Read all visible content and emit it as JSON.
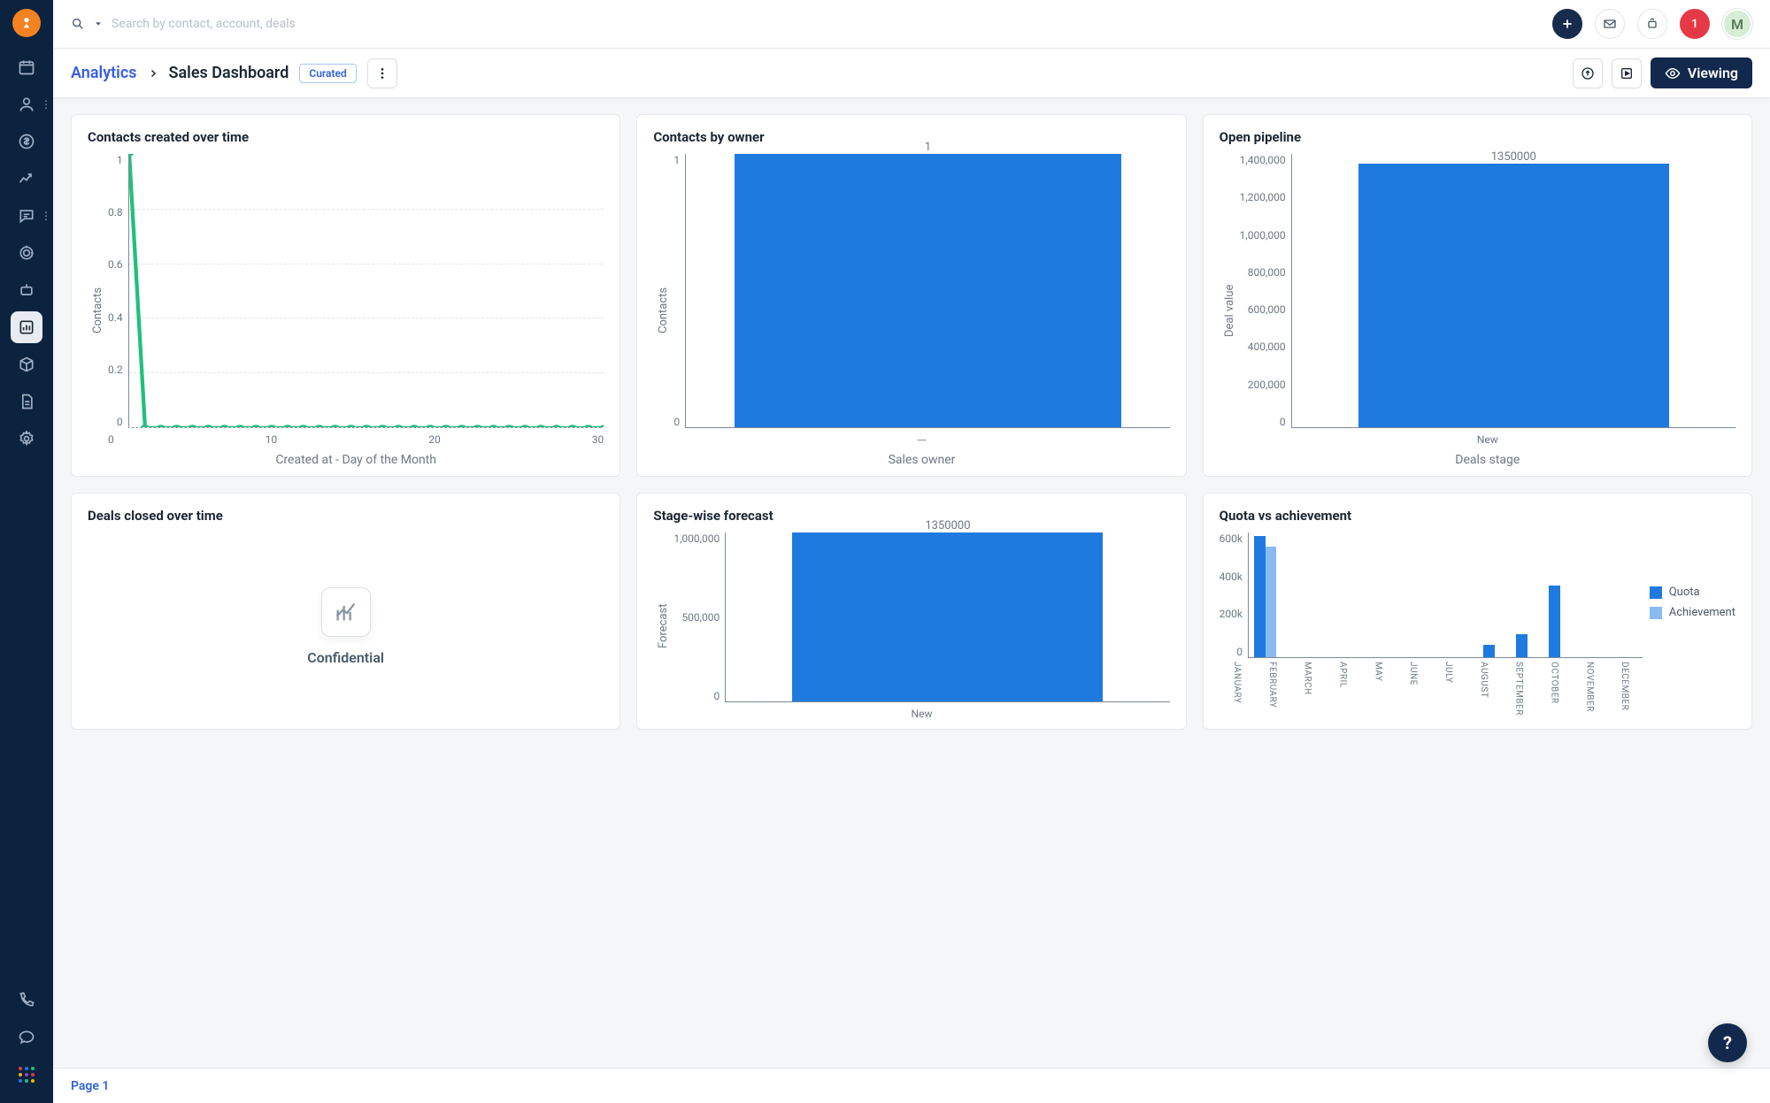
{
  "topbar": {
    "search_placeholder": "Search by contact, account, deals",
    "notification_count": "1",
    "avatar_initial": "M"
  },
  "breadcrumb": {
    "parent": "Analytics",
    "current": "Sales Dashboard",
    "badge": "Curated"
  },
  "toolbar": {
    "viewing_label": "Viewing"
  },
  "cards": {
    "c1": {
      "title": "Contacts created over time",
      "ylabel": "Contacts",
      "xlabel": "Created at - Day of the Month"
    },
    "c2": {
      "title": "Contacts by owner",
      "ylabel": "Contacts",
      "xlabel": "Sales owner"
    },
    "c3": {
      "title": "Open pipeline",
      "ylabel": "Deal value",
      "xlabel": "Deals stage"
    },
    "c4": {
      "title": "Deals closed over time",
      "empty_text": "Confidential"
    },
    "c5": {
      "title": "Stage-wise forecast",
      "ylabel": "Forecast"
    },
    "c6": {
      "title": "Quota vs achievement",
      "legend_quota": "Quota",
      "legend_ach": "Achievement"
    }
  },
  "footer": {
    "page_label": "Page 1"
  },
  "chart_data": [
    {
      "id": "contacts_over_time",
      "type": "line",
      "title": "Contacts created over time",
      "xlabel": "Created at - Day of the Month",
      "ylabel": "Contacts",
      "ylim": [
        0,
        1
      ],
      "y_ticks": [
        "1",
        "0.8",
        "0.6",
        "0.4",
        "0.2",
        "0"
      ],
      "x_ticks": [
        "0",
        "10",
        "20",
        "30"
      ],
      "x": [
        1,
        2,
        3,
        4,
        5,
        6,
        7,
        8,
        9,
        10,
        11,
        12,
        13,
        14,
        15,
        16,
        17,
        18,
        19,
        20,
        21,
        22,
        23,
        24,
        25,
        26,
        27,
        28,
        29,
        30,
        31
      ],
      "values": [
        1,
        0,
        0,
        0,
        0,
        0,
        0,
        0,
        0,
        0,
        0,
        0,
        0,
        0,
        0,
        0,
        0,
        0,
        0,
        0,
        0,
        0,
        0,
        0,
        0,
        0,
        0,
        0,
        0,
        0,
        0
      ],
      "color": "#22c07a"
    },
    {
      "id": "contacts_by_owner",
      "type": "bar",
      "title": "Contacts by owner",
      "xlabel": "Sales owner",
      "ylabel": "Contacts",
      "ylim": [
        0,
        1
      ],
      "y_ticks": [
        "1",
        "0"
      ],
      "categories": [
        "---"
      ],
      "values": [
        1
      ],
      "bar_label": "1"
    },
    {
      "id": "open_pipeline",
      "type": "bar",
      "title": "Open pipeline",
      "xlabel": "Deals stage",
      "ylabel": "Deal value",
      "ylim": [
        0,
        1400000
      ],
      "y_ticks": [
        "1,400,000",
        "1,200,000",
        "1,000,000",
        "800,000",
        "600,000",
        "400,000",
        "200,000",
        "0"
      ],
      "categories": [
        "New"
      ],
      "values": [
        1350000
      ],
      "bar_label": "1350000"
    },
    {
      "id": "stage_forecast",
      "type": "bar",
      "title": "Stage-wise forecast",
      "ylabel": "Forecast",
      "ylim": [
        0,
        1350000
      ],
      "y_ticks": [
        "1,000,000",
        "500,000",
        "0"
      ],
      "categories": [
        "New"
      ],
      "values": [
        1350000
      ],
      "bar_label": "1350000"
    },
    {
      "id": "quota_vs_achievement",
      "type": "bar",
      "title": "Quota vs achievement",
      "ylim": [
        0,
        700000
      ],
      "y_ticks": [
        "600k",
        "400k",
        "200k",
        "0"
      ],
      "categories": [
        "JANUARY",
        "FEBRUARY",
        "MARCH",
        "APRIL",
        "MAY",
        "JUNE",
        "JULY",
        "AUGUST",
        "SEPTEMBER",
        "OCTOBER",
        "NOVEMBER",
        "DECEMBER"
      ],
      "series": [
        {
          "name": "Quota",
          "color": "#1f7ae0",
          "values": [
            680000,
            0,
            0,
            0,
            0,
            0,
            0,
            70000,
            130000,
            400000,
            0,
            0
          ]
        },
        {
          "name": "Achievement",
          "color": "#8abaf4",
          "values": [
            620000,
            0,
            0,
            0,
            0,
            0,
            0,
            0,
            0,
            0,
            0,
            0
          ]
        }
      ]
    }
  ]
}
